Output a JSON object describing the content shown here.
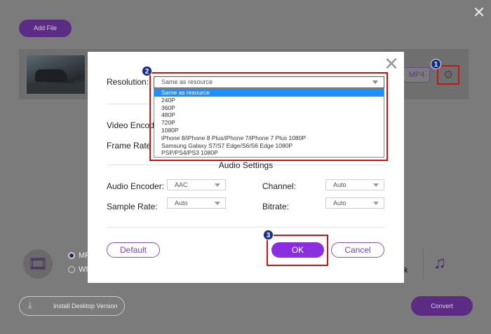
{
  "app": {
    "add_file_label": "Add File",
    "format_badge": "MP4",
    "video_option_label": "MP",
    "audio_option_label": "WI",
    "partial_text": "k",
    "install_label": "Install Desktop Version",
    "convert_label": "Convert",
    "icons": {
      "close": "close-icon",
      "gear": "gear-icon",
      "film": "film-icon",
      "music": "music-icon",
      "download": "download-icon"
    }
  },
  "dialog": {
    "resolution_label": "Resolution:",
    "resolution_value": "Same as resource",
    "resolution_options": [
      "Same as resource",
      "240P",
      "360P",
      "480P",
      "720P",
      "1080P",
      "iPhone 8/iPhone 8 Plus/iPhone 7/iPhone 7 Plus 1080P",
      "Samsung Galaxy S7/S7 Edge/S6/S6 Edge 1080P",
      "PSP/PS4/PS3 1080P"
    ],
    "video_encoder_label": "Video Encode",
    "frame_rate_label": "Frame Rate",
    "audio_section_title": "Audio Settings",
    "audio_encoder_label": "Audio Encoder:",
    "audio_encoder_value": "AAC",
    "channel_label": "Channel:",
    "channel_value": "Auto",
    "sample_rate_label": "Sample Rate:",
    "sample_rate_value": "Auto",
    "bitrate_label": "Bitrate:",
    "bitrate_value": "Auto",
    "default_label": "Default",
    "ok_label": "OK",
    "cancel_label": "Cancel"
  },
  "annotations": {
    "step1": "1",
    "step2": "2",
    "step3": "3",
    "highlight_color": "#c01818",
    "badge_color": "#142c8e"
  },
  "colors": {
    "accent": "#8b2ee0",
    "dropdown_highlight": "#1e8fff"
  }
}
